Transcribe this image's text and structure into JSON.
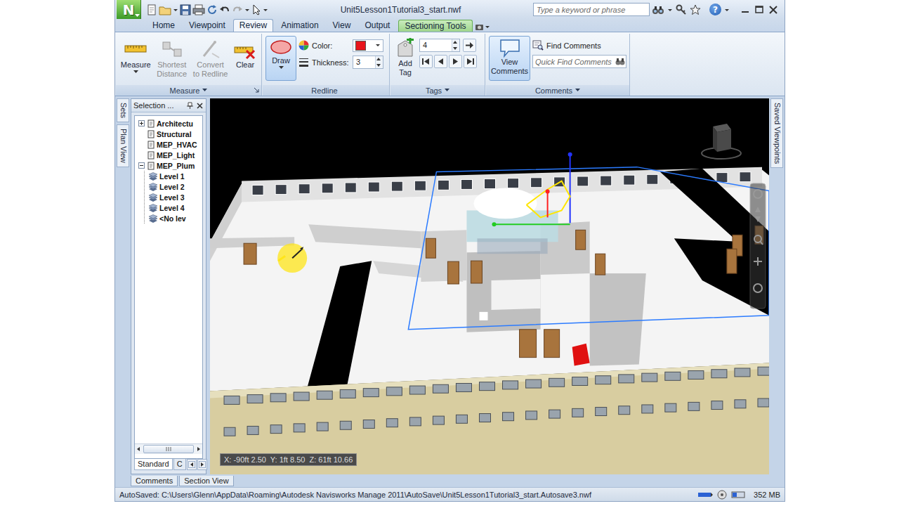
{
  "window": {
    "title": "Unit5Lesson1Tutorial3_start.nwf",
    "logo": "N"
  },
  "search": {
    "placeholder": "Type a keyword or phrase"
  },
  "help": "?",
  "ribbon_tabs": [
    {
      "label": "Home",
      "selected": false,
      "kind": "standard"
    },
    {
      "label": "Viewpoint",
      "selected": false,
      "kind": "standard"
    },
    {
      "label": "Review",
      "selected": true,
      "kind": "standard"
    },
    {
      "label": "Animation",
      "selected": false,
      "kind": "standard"
    },
    {
      "label": "View",
      "selected": false,
      "kind": "standard"
    },
    {
      "label": "Output",
      "selected": false,
      "kind": "standard"
    },
    {
      "label": "Sectioning Tools",
      "selected": false,
      "kind": "contextual"
    }
  ],
  "ribbon": {
    "measure": {
      "label": "Measure",
      "has_menu": true,
      "buttons": [
        {
          "lines": [
            "Measure"
          ],
          "disabled": false,
          "has_menu": true
        },
        {
          "lines": [
            "Shortest",
            "Distance"
          ],
          "disabled": true,
          "has_menu": false
        },
        {
          "lines": [
            "Convert",
            "to Redline"
          ],
          "disabled": true,
          "has_menu": false
        },
        {
          "lines": [
            "Clear"
          ],
          "disabled": false,
          "has_menu": false
        }
      ]
    },
    "redline": {
      "label": "Redline",
      "has_menu": false,
      "draw": {
        "label": "Draw",
        "selected": true,
        "has_menu": true
      },
      "color": {
        "label": "Color:",
        "value": "#e8141b"
      },
      "thickness": {
        "label": "Thickness:",
        "value": "3"
      }
    },
    "tags": {
      "label": "Tags",
      "has_menu": true,
      "add": {
        "lines": [
          "Add",
          "Tag"
        ]
      },
      "value": "4"
    },
    "comments": {
      "label": "Comments",
      "has_menu": true,
      "view": {
        "lines": [
          "View",
          "Comments"
        ],
        "selected": true
      },
      "find": "Find Comments",
      "quick_find": {
        "placeholder": "Quick Find Comments"
      }
    }
  },
  "side_tabs": [
    {
      "label": "Sets"
    },
    {
      "label": "Plan View"
    }
  ],
  "selection_tree": {
    "title": "Selection ...",
    "items": [
      {
        "label": "Architectu",
        "expander": "collapsed",
        "children": []
      },
      {
        "label": "Structural",
        "expander": "none",
        "children": []
      },
      {
        "label": "MEP_HVAC",
        "expander": "none",
        "children": []
      },
      {
        "label": "MEP_Light",
        "expander": "none",
        "children": []
      },
      {
        "label": "MEP_Plum",
        "expander": "expanded",
        "children": [
          {
            "label": "Level 1"
          },
          {
            "label": "Level 2"
          },
          {
            "label": "Level 3"
          },
          {
            "label": "Level 4"
          },
          {
            "label": "<No lev"
          }
        ]
      }
    ],
    "tabs": [
      {
        "label": "Standard",
        "selected": true
      },
      {
        "label": "C",
        "selected": false
      }
    ]
  },
  "viewport": {
    "coordinates": "X: -90ft 2.50  Y: 1ft 8.50  Z: 61ft 10.66"
  },
  "right_tabs": [
    {
      "label": "Saved Viewpoints"
    }
  ],
  "bottom_tabs": [
    {
      "label": "Comments",
      "selected": false
    },
    {
      "label": "Section View",
      "selected": false
    }
  ],
  "status_bar": {
    "text": "AutoSaved: C:\\Users\\Glenn\\AppData\\Roaming\\Autodesk Navisworks Manage 2011\\AutoSave\\Unit5Lesson1Tutorial3_start.Autosave3.nwf",
    "memory": "352 MB"
  }
}
